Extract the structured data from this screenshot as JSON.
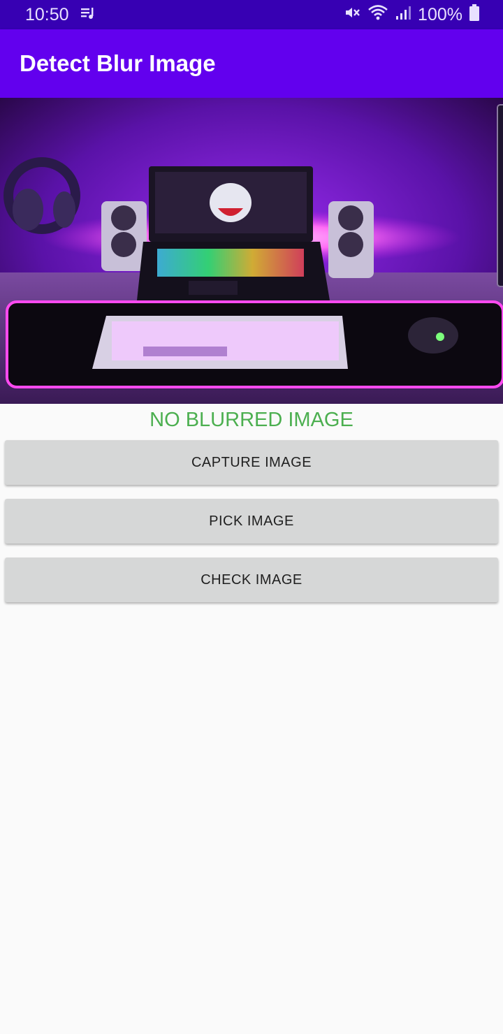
{
  "status_bar": {
    "time": "10:50",
    "battery_percent": "100%",
    "icons": [
      "music-notification-icon",
      "mute-icon",
      "wifi-icon",
      "signal-icon",
      "battery-icon"
    ]
  },
  "app_bar": {
    "title": "Detect Blur Image"
  },
  "result": {
    "text": "NO BLURRED IMAGE",
    "color": "#4caf50"
  },
  "buttons": {
    "capture": "CAPTURE IMAGE",
    "pick": "PICK IMAGE",
    "check": "CHECK IMAGE"
  },
  "colors": {
    "primary": "#6200ee",
    "primary_dark": "#3700b3",
    "button_bg": "#d6d7d7"
  }
}
